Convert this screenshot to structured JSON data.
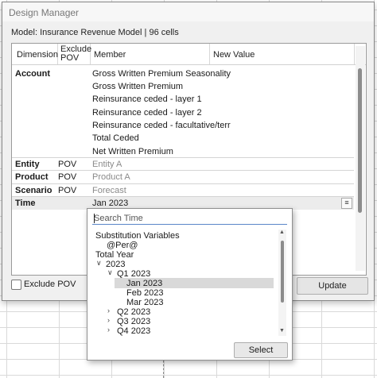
{
  "window": {
    "title": "Design Manager"
  },
  "model_label": "Model: Insurance Revenue Model | 96 cells",
  "columns": {
    "dimension": "Dimension",
    "exclude_pov_1": "Exclude",
    "exclude_pov_2": "POV",
    "member": "Member",
    "new_value": "New Value"
  },
  "rows": [
    {
      "dimension": "Account",
      "pov": "",
      "members": [
        "Gross Written Premium Seasonality",
        "Gross Written Premium",
        "Reinsurance ceded - layer 1",
        "Reinsurance ceded - layer 2",
        "Reinsurance ceded - facultative/terr",
        "Total Ceded",
        "Net Written Premium"
      ]
    },
    {
      "dimension": "Entity",
      "pov": "POV",
      "member": "Entity A"
    },
    {
      "dimension": "Product",
      "pov": "POV",
      "member": "Product A"
    },
    {
      "dimension": "Scenario",
      "pov": "POV",
      "member": "Forecast"
    },
    {
      "dimension": "Time",
      "pov": "",
      "member": "Jan 2023"
    }
  ],
  "exclude_pov_label": "Exclude POV",
  "update_label": "Update",
  "popup": {
    "search_placeholder": "Search Time",
    "tree": [
      {
        "label": "Substitution Variables",
        "chev": ""
      },
      {
        "label": "@Per@",
        "chev": ""
      },
      {
        "label": "Total Year",
        "chev": ""
      },
      {
        "label": "2023",
        "chev": "∨"
      },
      {
        "label": "Q1 2023",
        "chev": "∨"
      },
      {
        "label": "Jan 2023",
        "chev": "",
        "selected": true
      },
      {
        "label": "Feb 2023",
        "chev": ""
      },
      {
        "label": "Mar 2023",
        "chev": ""
      },
      {
        "label": "Q2 2023",
        "chev": "›"
      },
      {
        "label": "Q3 2023",
        "chev": "›"
      },
      {
        "label": "Q4 2023",
        "chev": "›"
      }
    ],
    "select_label": "Select"
  }
}
